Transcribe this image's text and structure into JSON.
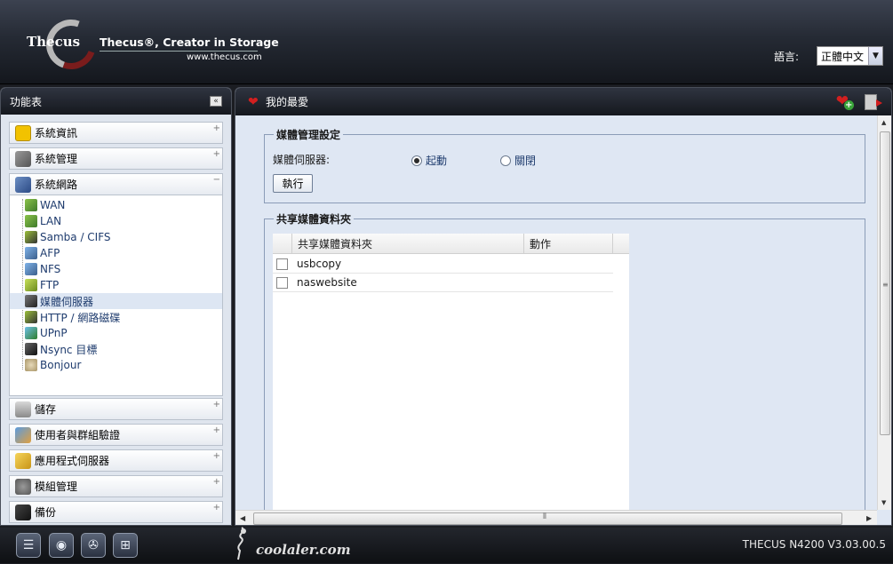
{
  "header": {
    "logo_text": "Thecus",
    "tagline": "Thecus®, Creator in Storage",
    "url": "www.thecus.com",
    "lang_label": "語言:",
    "lang_value": "正體中文"
  },
  "sidebar": {
    "title": "功能表",
    "categories_top": [
      {
        "label": "系統資訊",
        "icon": "info-icon",
        "toggle": "+"
      },
      {
        "label": "系統管理",
        "icon": "tools-icon",
        "toggle": "+"
      },
      {
        "label": "系統網路",
        "icon": "network-icon",
        "toggle": "−"
      }
    ],
    "network_items": [
      {
        "label": "WAN",
        "icon": "wan-icon"
      },
      {
        "label": "LAN",
        "icon": "lan-icon"
      },
      {
        "label": "Samba / CIFS",
        "icon": "samba-icon"
      },
      {
        "label": "AFP",
        "icon": "afp-icon"
      },
      {
        "label": "NFS",
        "icon": "nfs-icon"
      },
      {
        "label": "FTP",
        "icon": "ftp-icon"
      },
      {
        "label": "媒體伺服器",
        "icon": "media-server-icon",
        "active": true
      },
      {
        "label": "HTTP / 網路磁碟",
        "icon": "http-icon"
      },
      {
        "label": "UPnP",
        "icon": "upnp-icon"
      },
      {
        "label": "Nsync 目標",
        "icon": "nsync-icon"
      },
      {
        "label": "Bonjour",
        "icon": "bonjour-icon"
      }
    ],
    "categories_bottom": [
      {
        "label": "儲存",
        "icon": "storage-icon",
        "toggle": "+"
      },
      {
        "label": "使用者與群組驗證",
        "icon": "users-icon",
        "toggle": "+"
      },
      {
        "label": "應用程式伺服器",
        "icon": "app-server-icon",
        "toggle": "+"
      },
      {
        "label": "模組管理",
        "icon": "module-icon",
        "toggle": "+"
      },
      {
        "label": "備份",
        "icon": "backup-icon",
        "toggle": "+"
      }
    ]
  },
  "main": {
    "title": "我的最愛",
    "media_section": {
      "legend": "媒體管理設定",
      "server_label": "媒體伺服器:",
      "option_on": "起動",
      "option_off": "關閉",
      "selected": "起動",
      "execute_label": "執行"
    },
    "share_section": {
      "legend": "共享媒體資料夾",
      "columns": [
        "共享媒體資料夾",
        "動作"
      ],
      "rows": [
        "usbcopy",
        "naswebsite"
      ]
    }
  },
  "footer": {
    "icons": [
      "server-icon",
      "disk-icon",
      "fan-icon",
      "network-tree-icon"
    ],
    "version": "THECUS N4200 V3.03.00.5"
  },
  "watermark": {
    "text": "coolaler.com"
  },
  "colors": {
    "accent_red": "#d21f1f",
    "link_blue": "#1f3c6e",
    "panel_bg": "#dfe7f3"
  }
}
